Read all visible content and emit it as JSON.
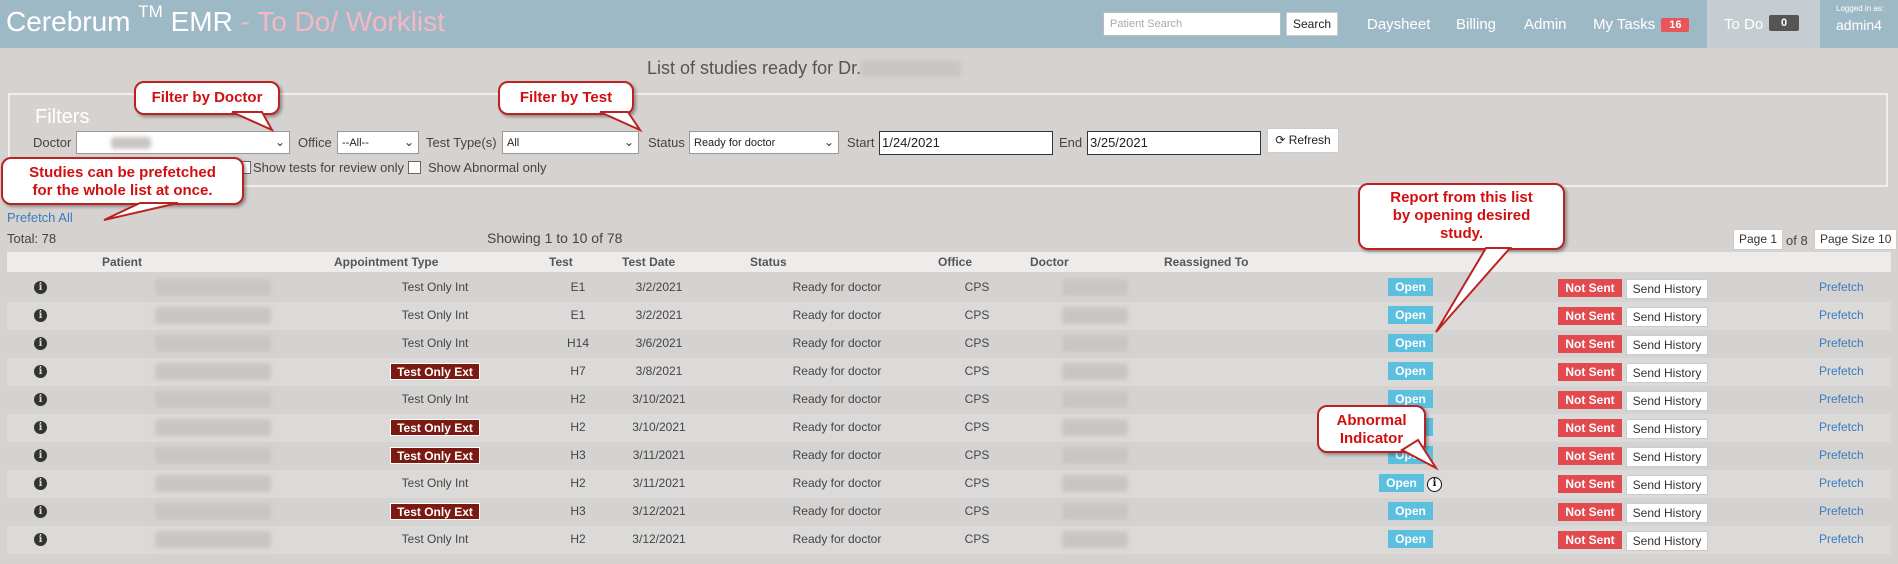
{
  "app": {
    "brand": "Cerebrum",
    "tm": "TM",
    "emr": "EMR",
    "page_suffix": " - To Do/ Worklist"
  },
  "nav": {
    "search_placeholder": "Patient Search",
    "search_button": "Search",
    "daysheet": "Daysheet",
    "billing": "Billing",
    "admin": "Admin",
    "my_tasks": "My Tasks",
    "my_tasks_count": "16",
    "todo": "To Do",
    "todo_count": "0",
    "logged_in_label": "Logged in as:",
    "username": "admin4"
  },
  "headline": "List of studies ready for Dr.",
  "filters": {
    "title": "Filters",
    "doctor_label": "Doctor",
    "doctor_value": "",
    "office_label": "Office",
    "office_value": "--All--",
    "test_type_label": "Test Type(s)",
    "test_type_value": "All",
    "status_label": "Status",
    "status_value": "Ready for doctor",
    "start_label": "Start",
    "start_value": "1/24/2021",
    "end_label": "End",
    "end_value": "3/25/2021",
    "refresh_label": "Refresh",
    "review_only_label": "Show tests for review only",
    "abnormal_only_label": "Show Abnormal only"
  },
  "list_meta": {
    "prefetch_all": "Prefetch All",
    "total": "Total: 78",
    "showing": "Showing 1 to 10 of 78",
    "page": "Page 1",
    "of_pages": "of 8",
    "page_size": "Page Size 10"
  },
  "table": {
    "columns": [
      "Patient",
      "Appointment Type",
      "Test",
      "Test Date",
      "Status",
      "Office",
      "Doctor",
      "Reassigned To"
    ],
    "rows": [
      {
        "appt": "Test Only Int",
        "ext": false,
        "test": "E1",
        "date": "3/2/2021",
        "status": "Ready for doctor",
        "office": "CPS",
        "abnormal": false
      },
      {
        "appt": "Test Only Int",
        "ext": false,
        "test": "E1",
        "date": "3/2/2021",
        "status": "Ready for doctor",
        "office": "CPS",
        "abnormal": false
      },
      {
        "appt": "Test Only Int",
        "ext": false,
        "test": "H14",
        "date": "3/6/2021",
        "status": "Ready for doctor",
        "office": "CPS",
        "abnormal": false
      },
      {
        "appt": "Test Only Ext",
        "ext": true,
        "test": "H7",
        "date": "3/8/2021",
        "status": "Ready for doctor",
        "office": "CPS",
        "abnormal": false
      },
      {
        "appt": "Test Only Int",
        "ext": false,
        "test": "H2",
        "date": "3/10/2021",
        "status": "Ready for doctor",
        "office": "CPS",
        "abnormal": false
      },
      {
        "appt": "Test Only Ext",
        "ext": true,
        "test": "H2",
        "date": "3/10/2021",
        "status": "Ready for doctor",
        "office": "CPS",
        "abnormal": false
      },
      {
        "appt": "Test Only Ext",
        "ext": true,
        "test": "H3",
        "date": "3/11/2021",
        "status": "Ready for doctor",
        "office": "CPS",
        "abnormal": false
      },
      {
        "appt": "Test Only Int",
        "ext": false,
        "test": "H2",
        "date": "3/11/2021",
        "status": "Ready for doctor",
        "office": "CPS",
        "abnormal": true
      },
      {
        "appt": "Test Only Ext",
        "ext": true,
        "test": "H3",
        "date": "3/12/2021",
        "status": "Ready for doctor",
        "office": "CPS",
        "abnormal": false
      },
      {
        "appt": "Test Only Int",
        "ext": false,
        "test": "H2",
        "date": "3/12/2021",
        "status": "Ready for doctor",
        "office": "CPS",
        "abnormal": false
      }
    ],
    "open_label": "Open",
    "not_sent_label": "Not Sent",
    "send_history_label": "Send History",
    "prefetch_label": "Prefetch",
    "info_icon": "info-circle-icon",
    "abnormal_icon": "abnormal-info-icon"
  },
  "callouts": {
    "filter_doctor": "Filter by Doctor",
    "filter_test": "Filter by Test",
    "prefetch_line1": "Studies can be prefetched",
    "prefetch_line2": "for the whole list at once.",
    "report_line1": "Report from this list",
    "report_line2": "by opening desired",
    "report_line3": "study.",
    "abnormal_line1": "Abnormal",
    "abnormal_line2": "Indicator"
  },
  "colors": {
    "nav_bg": "#9eb9c6",
    "page_bg": "#d6d2cf",
    "open_button": "#5bc0de",
    "not_sent": "#e14a4e",
    "ext_badge": "#7a1a12",
    "callout_text": "#d01010",
    "link": "#3a7bbf"
  }
}
